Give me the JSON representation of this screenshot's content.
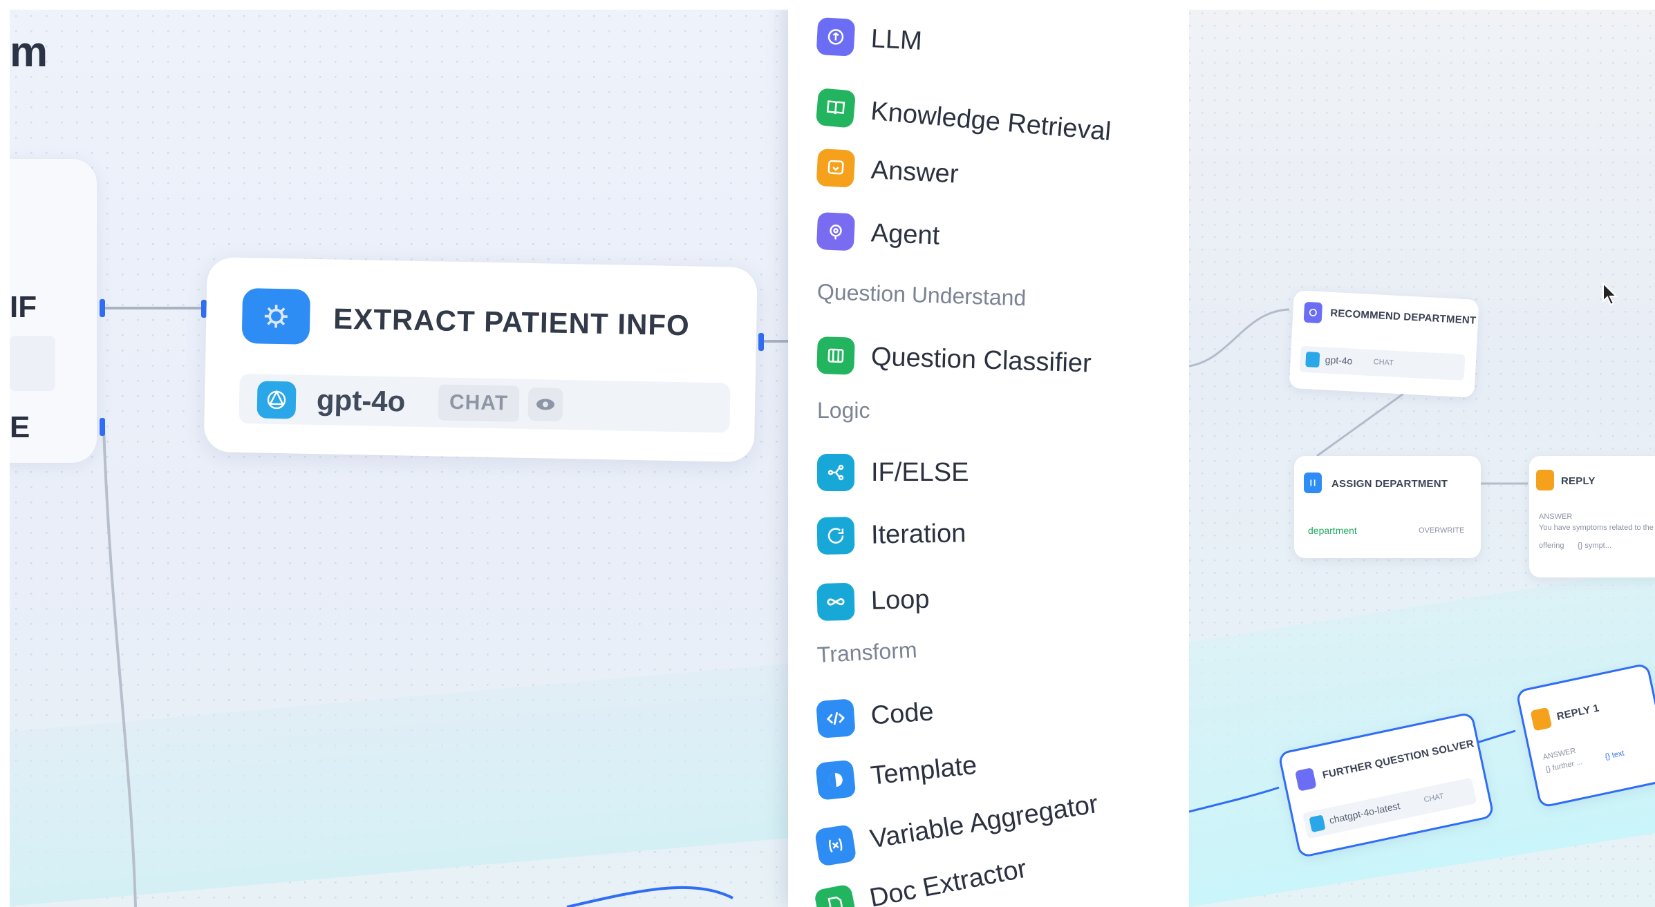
{
  "canvas": {
    "partial_title": "m",
    "ifelse_node": {
      "if_label": "IF",
      "else_label": "E"
    },
    "extract_node": {
      "title": "EXTRACT PATIENT INFO",
      "model": "gpt-4o",
      "mode_badge": "CHAT",
      "icon": "brain-icon",
      "model_icon": "openai-icon",
      "view_icon": "eye-icon"
    }
  },
  "node_menu": {
    "items_top": [
      {
        "label": "LLM",
        "icon": "llm-icon",
        "color": "#6b6ef5"
      },
      {
        "label": "Knowledge Retrieval",
        "icon": "book-icon",
        "color": "#22b45e"
      },
      {
        "label": "Answer",
        "icon": "message-icon",
        "color": "#f5a11c"
      },
      {
        "label": "Agent",
        "icon": "agent-icon",
        "color": "#7a6cf0"
      }
    ],
    "section_question": "Question Understand",
    "items_question": [
      {
        "label": "Question Classifier",
        "icon": "classifier-icon",
        "color": "#22b45e"
      }
    ],
    "section_logic": "Logic",
    "items_logic": [
      {
        "label": "IF/ELSE",
        "icon": "branch-icon",
        "color": "#18a8d8"
      },
      {
        "label": "Iteration",
        "icon": "repeat-icon",
        "color": "#18a8d8"
      },
      {
        "label": "Loop",
        "icon": "infinity-icon",
        "color": "#18a8d8"
      }
    ],
    "section_transform": "Transform",
    "items_transform": [
      {
        "label": "Code",
        "icon": "code-icon",
        "color": "#2e8cf5"
      },
      {
        "label": "Template",
        "icon": "template-icon",
        "color": "#2e8cf5"
      },
      {
        "label": "Variable Aggregator",
        "icon": "variable-icon",
        "color": "#2e8cf5"
      },
      {
        "label": "Doc Extractor",
        "icon": "doc-icon",
        "color": "#22b45e"
      }
    ]
  },
  "right_canvas": {
    "recommend": {
      "title": "RECOMMEND DEPARTMENT",
      "model": "gpt-4o",
      "badge": "CHAT"
    },
    "assign": {
      "title": "ASSIGN DEPARTMENT",
      "field": "department",
      "type": "OVERWRITE"
    },
    "reply": {
      "title": "REPLY",
      "line1": "ANSWER",
      "line2": "You have symptoms related to the f",
      "line3": "offering",
      "line4": "{} sympt..."
    },
    "further": {
      "title": "FURTHER QUESTION SOLVER",
      "model": "chatgpt-4o-latest",
      "badge": "CHAT"
    },
    "reply1": {
      "title": "REPLY 1",
      "line1": "ANSWER",
      "line2": "{} further ...",
      "line3": "{} text"
    }
  }
}
